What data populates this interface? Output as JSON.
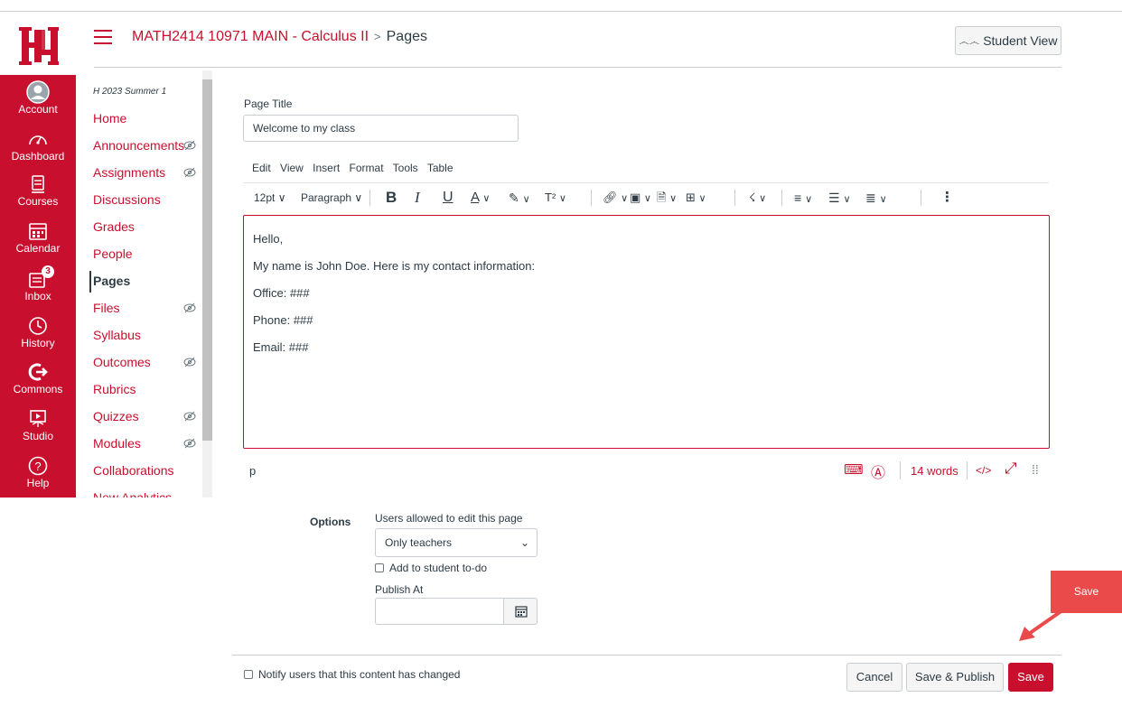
{
  "nav": {
    "logo": "UH",
    "items": [
      {
        "label": "Account",
        "icon": "account-icon"
      },
      {
        "label": "Dashboard",
        "icon": "dashboard-icon"
      },
      {
        "label": "Courses",
        "icon": "courses-icon"
      },
      {
        "label": "Calendar",
        "icon": "calendar-icon"
      },
      {
        "label": "Inbox",
        "icon": "inbox-icon",
        "badge": "3"
      },
      {
        "label": "History",
        "icon": "history-icon"
      },
      {
        "label": "Commons",
        "icon": "commons-icon"
      },
      {
        "label": "Studio",
        "icon": "studio-icon"
      },
      {
        "label": "Help",
        "icon": "help-icon"
      }
    ]
  },
  "header": {
    "course": "MATH2414 10971 MAIN - Calculus II",
    "separator": ">",
    "page": "Pages",
    "student_view": "Student View"
  },
  "course_nav": {
    "term": "H 2023 Summer 1",
    "items": [
      {
        "label": "Home"
      },
      {
        "label": "Announcements",
        "hidden": true
      },
      {
        "label": "Assignments",
        "hidden": true
      },
      {
        "label": "Discussions"
      },
      {
        "label": "Grades"
      },
      {
        "label": "People"
      },
      {
        "label": "Pages",
        "active": true
      },
      {
        "label": "Files",
        "hidden": true
      },
      {
        "label": "Syllabus"
      },
      {
        "label": "Outcomes",
        "hidden": true
      },
      {
        "label": "Rubrics"
      },
      {
        "label": "Quizzes",
        "hidden": true
      },
      {
        "label": "Modules",
        "hidden": true
      },
      {
        "label": "Collaborations"
      },
      {
        "label": "New Analytics"
      }
    ]
  },
  "editor": {
    "page_title_label": "Page Title",
    "page_title_value": "Welcome to my class",
    "menu": [
      "Edit",
      "View",
      "Insert",
      "Format",
      "Tools",
      "Table"
    ],
    "toolbar": {
      "font_size": "12pt",
      "block": "Paragraph",
      "bold": "B",
      "italic": "I",
      "underline": "U",
      "text_color": "A",
      "superscript": "T²",
      "more": "⋮"
    },
    "body": [
      "Hello,",
      "My name is John Doe. Here is my contact information:",
      "Office: ###",
      "Phone: ###",
      "Email: ###"
    ],
    "status_path": "p",
    "word_count": "14 words",
    "html_toggle": "</>"
  },
  "options": {
    "label": "Options",
    "edit_label": "Users allowed to edit this page",
    "edit_value": "Only teachers",
    "todo_label": "Add to student to-do",
    "publish_at_label": "Publish At",
    "publish_at_value": ""
  },
  "footer": {
    "notify_label": "Notify users that this content has changed",
    "cancel": "Cancel",
    "save_publish": "Save & Publish",
    "save": "Save"
  },
  "annotation": {
    "callout": "Save"
  },
  "colors": {
    "brand": "#c8102e",
    "text": "#2d3b45",
    "border": "#c7cdd1",
    "callout": "#ea4a4a"
  }
}
